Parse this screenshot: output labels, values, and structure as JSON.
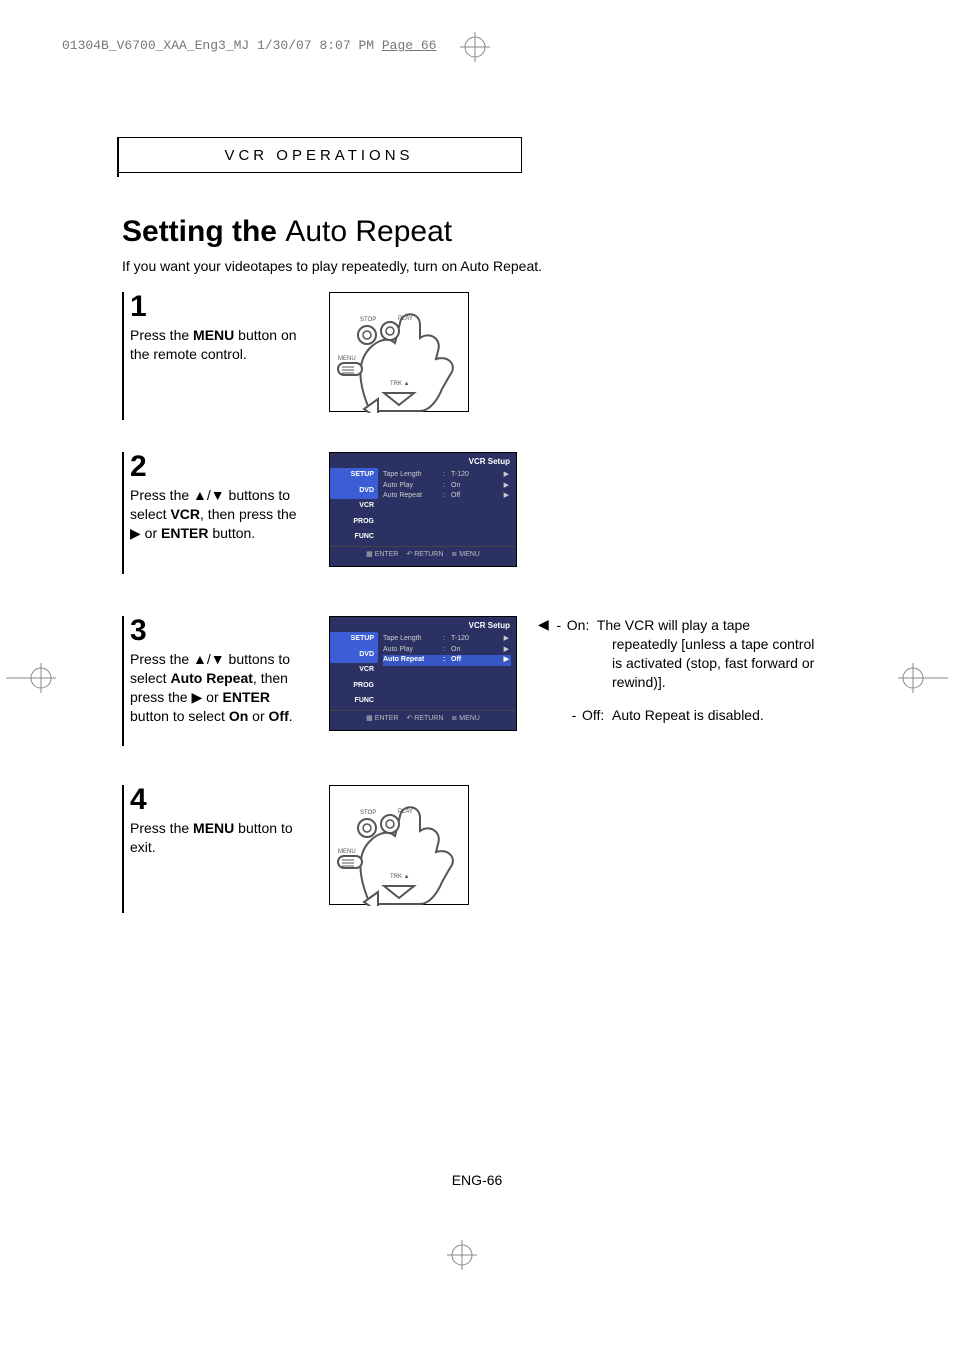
{
  "header": {
    "file_info": "01304B_V6700_XAA_Eng3_MJ  1/30/07  8:07 PM  ",
    "page_label": "Page 66"
  },
  "section_header": "VCR OPERATIONS",
  "title_prefix": "Setting the ",
  "title_bold": "Auto Repeat",
  "intro": "If you want your videotapes to play repeatedly, turn on Auto Repeat.",
  "steps": {
    "s1": {
      "num": "1",
      "t1": "Press the ",
      "menu": "MENU",
      "t2": " button on the remote control."
    },
    "s2": {
      "num": "2",
      "t1": "Press the ",
      "t2": " buttons to select ",
      "vcr": "VCR",
      "t3": ", then press the ",
      "t4": " or ",
      "enter": "ENTER",
      "t5": " button."
    },
    "s3": {
      "num": "3",
      "t1": "Press the ",
      "t2": " buttons to select ",
      "autorep": "Auto Repeat",
      "t3": ", then press the ",
      "t4": " or ",
      "enter": "ENTER",
      "t5": " button to select ",
      "on": "On",
      "t6": " or ",
      "off": "Off",
      "t7": "."
    },
    "s4": {
      "num": "4",
      "t1": "Press the ",
      "menu": "MENU",
      "t2": " button to exit."
    }
  },
  "osd": {
    "title": "VCR Setup",
    "tabs": [
      "SETUP",
      "DVD",
      "VCR",
      "PROG",
      "FUNC"
    ],
    "rows": [
      {
        "k": "Tape Length",
        "v": "T-120"
      },
      {
        "k": "Auto Play",
        "v": "On"
      },
      {
        "k": "Auto Repeat",
        "v": "Off"
      }
    ],
    "foot": [
      "ENTER",
      "RETURN",
      "MENU"
    ]
  },
  "side_note": {
    "on_label": "On:",
    "on_text_l1": "The VCR will play a tape",
    "on_text_l2": "repeatedly [unless a tape control",
    "on_text_l3": "is activated (stop, fast forward or",
    "on_text_l4": "rewind)].",
    "off_label": "Off:",
    "off_text": "Auto Repeat is disabled."
  },
  "remote_labels": {
    "stop": "STOP",
    "play": "PLAY",
    "menu": "MENU",
    "trk": "TRK"
  },
  "page_number": "ENG-66"
}
